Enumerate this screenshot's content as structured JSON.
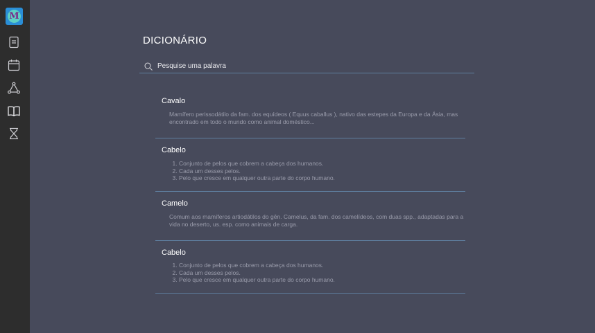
{
  "sidebar": {
    "logo_letter": "M",
    "icons": [
      "notes-icon",
      "calendar-icon",
      "graph-icon",
      "book-icon",
      "hourglass-icon"
    ]
  },
  "page": {
    "title": "DICIONÁRIO"
  },
  "search": {
    "placeholder": "Pesquise uma palavra"
  },
  "entries": [
    {
      "word": "Cavalo",
      "definition": "Mamífero perissodátilo da fam. dos equídeos ( Equus caballus ), nativo das estepes da Europa e da Ásia, mas encontrado em todo o mundo como animal doméstico..."
    },
    {
      "word": "Cabelo",
      "items": [
        "Conjunto de pelos que cobrem a cabeça dos humanos.",
        "Cada um desses pelos.",
        "Pelo que cresce em qualquer outra parte do corpo humano."
      ]
    },
    {
      "word": "Camelo",
      "definition": "Comum aos mamíferos artiodátilos do gên. Camelus, da fam. dos camelídeos, com duas spp., adaptadas para a vida no deserto, us. esp. como animais de carga."
    },
    {
      "word": "Cabelo",
      "items": [
        "Conjunto de pelos que cobrem a cabeça dos humanos.",
        "Cada um desses pelos.",
        "Pelo que cresce em qualquer outra parte do corpo humano."
      ]
    }
  ]
}
